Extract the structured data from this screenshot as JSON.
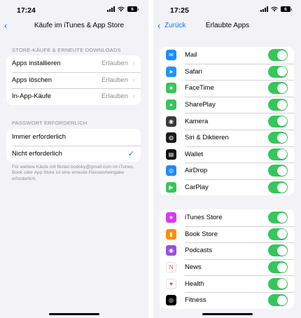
{
  "left": {
    "status": {
      "time": "17:24",
      "battery": "6"
    },
    "nav": {
      "title": "Käufe im iTunes & App Store"
    },
    "section1": {
      "header": "STORE-KÄUFE & ERNEUTE DOWNLOADS",
      "rows": [
        {
          "label": "Apps installieren",
          "value": "Erlauben"
        },
        {
          "label": "Apps löschen",
          "value": "Erlauben"
        },
        {
          "label": "In-App-Käufe",
          "value": "Erlauben"
        }
      ]
    },
    "section2": {
      "header": "PASSWORT ERFORDERLICH",
      "rows": [
        {
          "label": "Immer erforderlich",
          "selected": false
        },
        {
          "label": "Nicht erforderlich",
          "selected": true
        }
      ]
    },
    "footer": "Für weitere Käufe mit florian.bodoky@gmail.com im iTunes, Book oder App Store ist eine erneute Passworteingabe erforderlich."
  },
  "right": {
    "status": {
      "time": "17:25",
      "battery": "6"
    },
    "nav": {
      "back": "Zurück",
      "title": "Erlaubte Apps"
    },
    "group1": [
      {
        "label": "Mail",
        "icon": "mail-icon",
        "glyph": "✉",
        "color": "#1a8cff",
        "on": true
      },
      {
        "label": "Safari",
        "icon": "safari-icon",
        "glyph": "➤",
        "color": "#2196f3",
        "on": true
      },
      {
        "label": "FaceTime",
        "icon": "facetime-icon",
        "glyph": "■",
        "color": "#34c759",
        "on": true
      },
      {
        "label": "SharePlay",
        "icon": "shareplay-icon",
        "glyph": "●",
        "color": "#34c759",
        "on": true
      },
      {
        "label": "Kamera",
        "icon": "camera-icon",
        "glyph": "◉",
        "color": "#3a3a3c",
        "on": true
      },
      {
        "label": "Siri & Diktieren",
        "icon": "siri-icon",
        "glyph": "◍",
        "color": "#1c1c1e",
        "on": true
      },
      {
        "label": "Wallet",
        "icon": "wallet-icon",
        "glyph": "▤",
        "color": "#111111",
        "on": true
      },
      {
        "label": "AirDrop",
        "icon": "airdrop-icon",
        "glyph": "◎",
        "color": "#1a8cff",
        "on": true
      },
      {
        "label": "CarPlay",
        "icon": "carplay-icon",
        "glyph": "▶",
        "color": "#34c759",
        "on": true
      }
    ],
    "group2": [
      {
        "label": "iTunes Store",
        "icon": "itunes-store-icon",
        "glyph": "★",
        "color": "#d53af0",
        "on": true
      },
      {
        "label": "Book Store",
        "icon": "book-store-icon",
        "glyph": "▮",
        "color": "#ff8c00",
        "on": true
      },
      {
        "label": "Podcasts",
        "icon": "podcasts-icon",
        "glyph": "◉",
        "color": "#9b4dde",
        "on": true
      },
      {
        "label": "News",
        "icon": "news-icon",
        "glyph": "N",
        "color": "#ffffff",
        "on": true
      },
      {
        "label": "Health",
        "icon": "health-icon",
        "glyph": "♥",
        "color": "#ffffff",
        "on": true
      },
      {
        "label": "Fitness",
        "icon": "fitness-icon",
        "glyph": "◎",
        "color": "#000000",
        "on": true
      }
    ]
  }
}
